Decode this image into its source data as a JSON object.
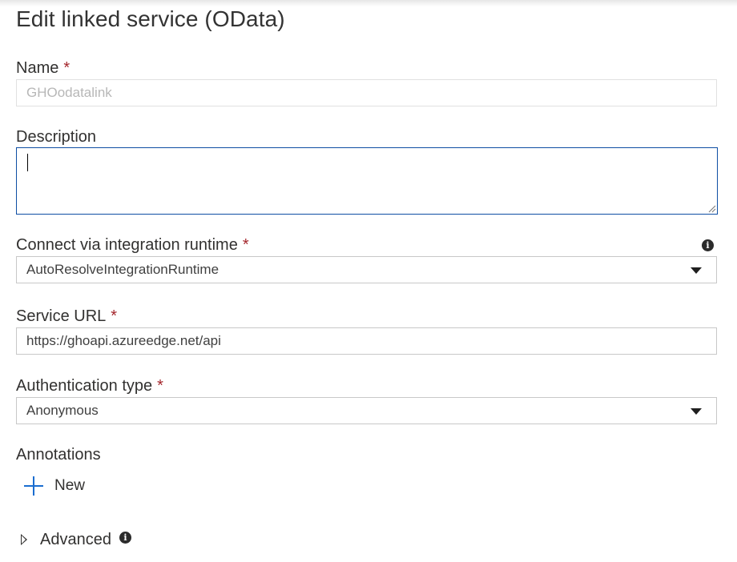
{
  "panel": {
    "title": "Edit linked service (OData)"
  },
  "form": {
    "name": {
      "label": "Name",
      "required_mark": "*",
      "value": "GHOodatalink"
    },
    "description": {
      "label": "Description",
      "value": ""
    },
    "runtime": {
      "label": "Connect via integration runtime",
      "required_mark": "*",
      "value": "AutoResolveIntegrationRuntime",
      "info_icon": "info-icon"
    },
    "service_url": {
      "label": "Service URL",
      "required_mark": "*",
      "value": "https://ghoapi.azureedge.net/api"
    },
    "auth_type": {
      "label": "Authentication type",
      "required_mark": "*",
      "value": "Anonymous"
    }
  },
  "annotations": {
    "label": "Annotations",
    "new_label": "New",
    "icon": "plus-icon"
  },
  "advanced": {
    "label": "Advanced",
    "icon": "chevron-right-icon",
    "info_icon": "info-icon"
  },
  "colors": {
    "required": "#a4262c",
    "accent": "#1a6dd0",
    "focus_border": "#0e4ea3"
  }
}
